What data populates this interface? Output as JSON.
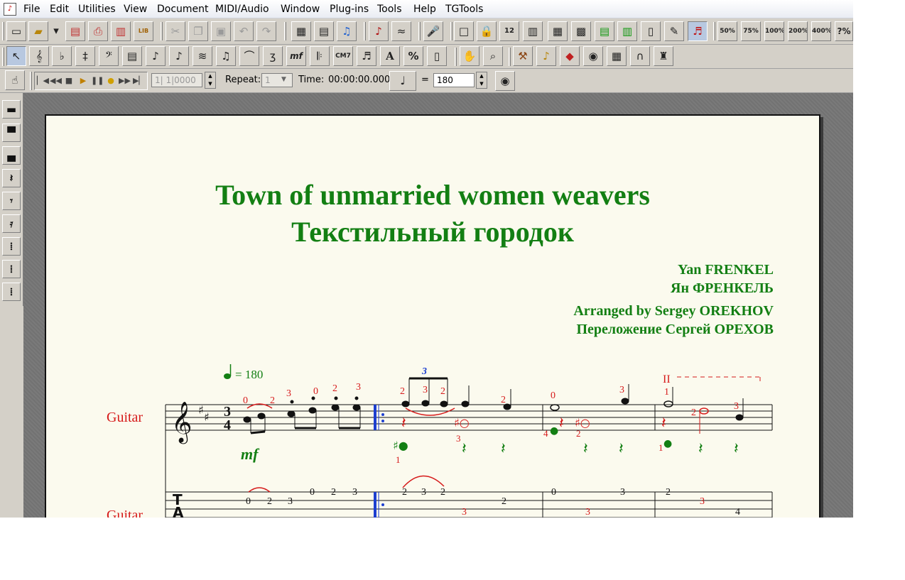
{
  "menu": [
    "File",
    "Edit",
    "Utilities",
    "View",
    "Document",
    "MIDI/Audio",
    "Window",
    "Plug-ins",
    "Tools",
    "Help",
    "TGTools"
  ],
  "toolbar1_zoom": [
    "50%",
    "75%",
    "100%",
    "200%",
    "400%",
    "?%"
  ],
  "toolbar2_text": {
    "chord": "CM7",
    "text_tool": "A",
    "percent_tool": "%"
  },
  "playback": {
    "position": "1|  1|0000",
    "repeat_label": "Repeat:",
    "repeat_value": "1",
    "time_label": "Time:",
    "time_value": "00:00:00.000",
    "equals": "=",
    "tempo_value": "180"
  },
  "score": {
    "title": "Town of unmarried women weavers",
    "subtitle": "Текстильный городок",
    "composer": "Yan FRENKEL",
    "composer_ru": "Ян ФРЕНКЕЛЬ",
    "arranger": "Arranged by Sergey OREKHOV",
    "arranger_ru": "Переложение Сергей ОРЕХОВ",
    "tempo_text": "= 180",
    "instrument_staff": "Guitar",
    "instrument_tab": "Guitar",
    "dynamic": "mf",
    "position_marking": "II",
    "triplet": "3",
    "fingerings_red": [
      "0",
      "2",
      "3",
      "0",
      "2",
      "3",
      "2",
      "3",
      "2",
      "2",
      "0",
      "3",
      "1",
      "4",
      "3",
      "2",
      "1",
      "2",
      "3"
    ],
    "tab_numbers": [
      "0",
      "2",
      "3",
      "0",
      "2",
      "3",
      "2",
      "3",
      "2",
      "2",
      "3",
      "0",
      "3",
      "3",
      "2",
      "3",
      "4"
    ]
  }
}
